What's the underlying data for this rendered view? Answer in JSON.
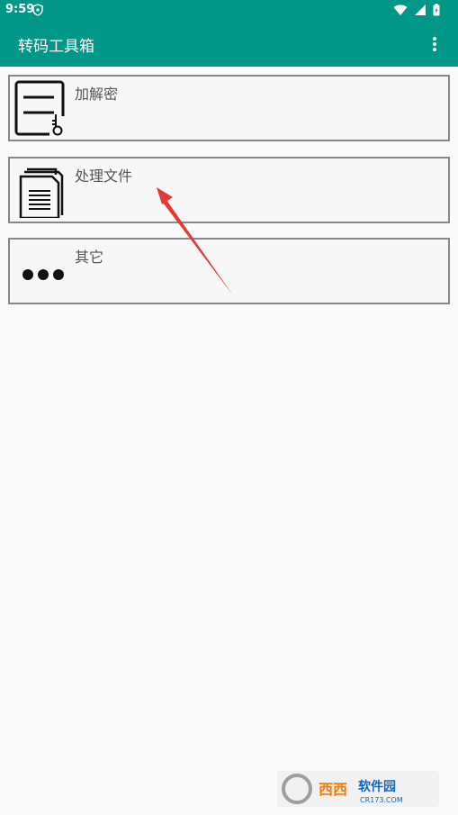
{
  "status_bar": {
    "time": "9:59"
  },
  "app_bar": {
    "title": "转码工具箱"
  },
  "items": [
    {
      "label": "加解密",
      "icon": "document-key-icon"
    },
    {
      "label": "处理文件",
      "icon": "files-icon"
    },
    {
      "label": "其它",
      "icon": "more-dots-icon"
    }
  ],
  "watermark": {
    "text": "西西软件园",
    "subtext": "CR173.COM"
  },
  "colors": {
    "primary": "#009688",
    "background": "#fafafa",
    "card_border": "#888888",
    "arrow": "#e53935"
  }
}
